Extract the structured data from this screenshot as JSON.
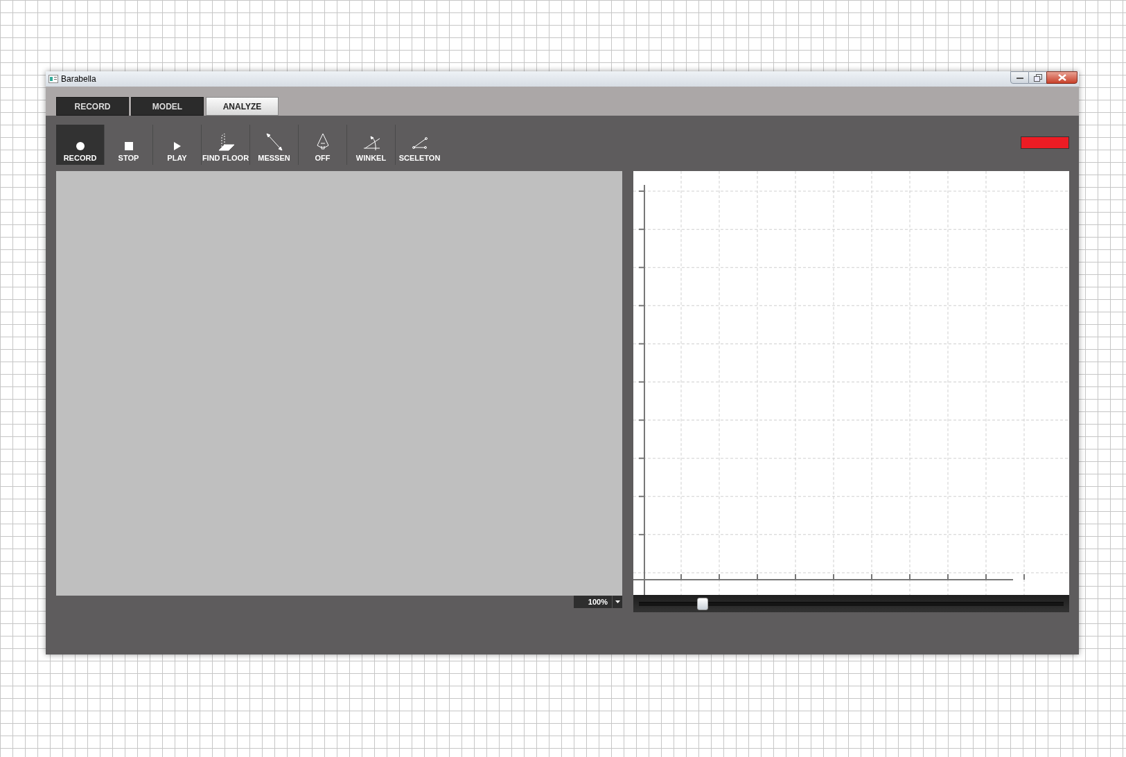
{
  "window": {
    "title": "Barabella"
  },
  "tabs": [
    {
      "label": "RECORD",
      "selected": false
    },
    {
      "label": "MODEL",
      "selected": false
    },
    {
      "label": "ANALYZE",
      "selected": true
    }
  ],
  "tools": [
    {
      "kind": "record",
      "label": "RECORD",
      "selected": true
    },
    {
      "kind": "stop",
      "label": "STOP",
      "selected": false
    },
    {
      "kind": "play",
      "label": "PLAY",
      "selected": false
    },
    {
      "kind": "floor",
      "label": "FIND FLOOR",
      "selected": false
    },
    {
      "kind": "measure",
      "label": "MESSEN",
      "selected": false
    },
    {
      "kind": "cone",
      "label": "OFF",
      "selected": false
    },
    {
      "kind": "angle",
      "label": "WINKEL",
      "selected": false
    },
    {
      "kind": "skeleton",
      "label": "SCELETON",
      "selected": false
    }
  ],
  "zoom": {
    "value": "100%"
  },
  "timeline": {
    "level": 0.15
  }
}
